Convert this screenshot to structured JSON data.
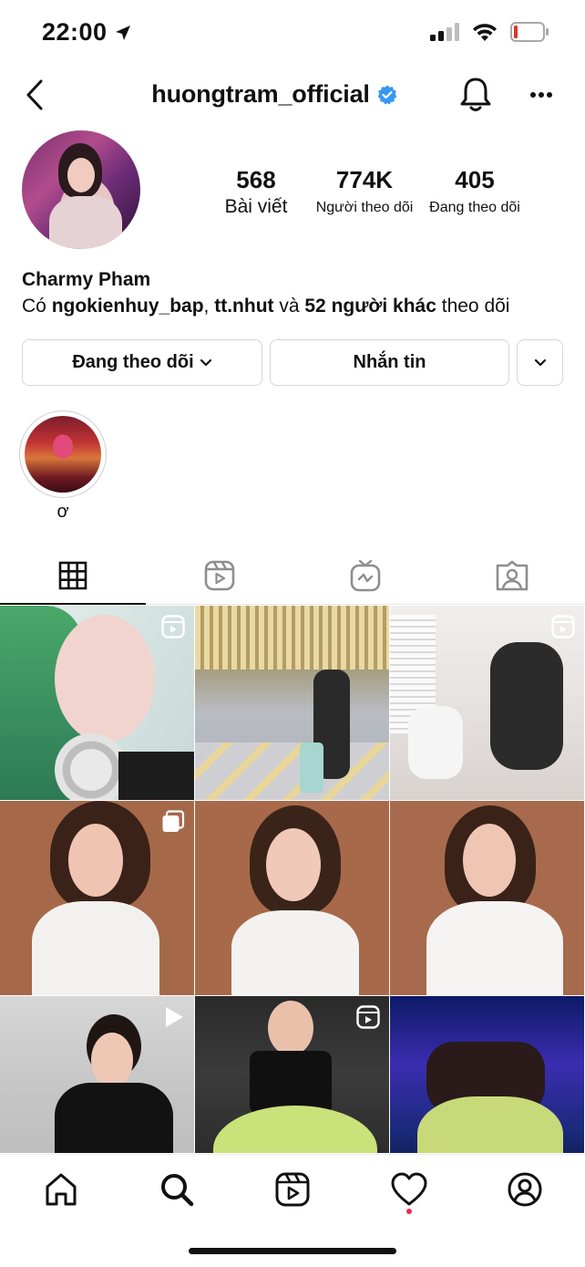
{
  "status_bar": {
    "time": "22:00",
    "battery_color": "#e0342b"
  },
  "header": {
    "username": "huongtram_official",
    "verified_color": "#3897f0"
  },
  "profile": {
    "stats": [
      {
        "value": "568",
        "label": "Bài viết"
      },
      {
        "value": "774K",
        "label": "Người theo dõi"
      },
      {
        "value": "405",
        "label": "Đang theo dõi"
      }
    ],
    "name": "Charmy Pham",
    "followed_by": {
      "prefix": "Có ",
      "user1": "ngokienhuy_bap",
      "sep": ", ",
      "user2": "tt.nhut",
      "and": " và ",
      "others": "52 người khác",
      "suffix": " theo dõi"
    }
  },
  "actions": {
    "following_label": "Đang theo dõi",
    "message_label": "Nhắn tin"
  },
  "highlights": [
    {
      "label": "ơ"
    }
  ],
  "tabs": [
    "grid-icon",
    "reels-icon",
    "igtv-icon",
    "tagged-icon"
  ],
  "posts": [
    {
      "type": "reel"
    },
    {
      "type": "photo"
    },
    {
      "type": "reel"
    },
    {
      "type": "carousel"
    },
    {
      "type": "photo"
    },
    {
      "type": "photo"
    },
    {
      "type": "video"
    },
    {
      "type": "reel"
    },
    {
      "type": "photo"
    }
  ],
  "bottom_nav": [
    "home-icon",
    "search-icon",
    "reels-icon",
    "heart-icon",
    "profile-icon"
  ],
  "notification_dot_color": "#ef2b4b"
}
